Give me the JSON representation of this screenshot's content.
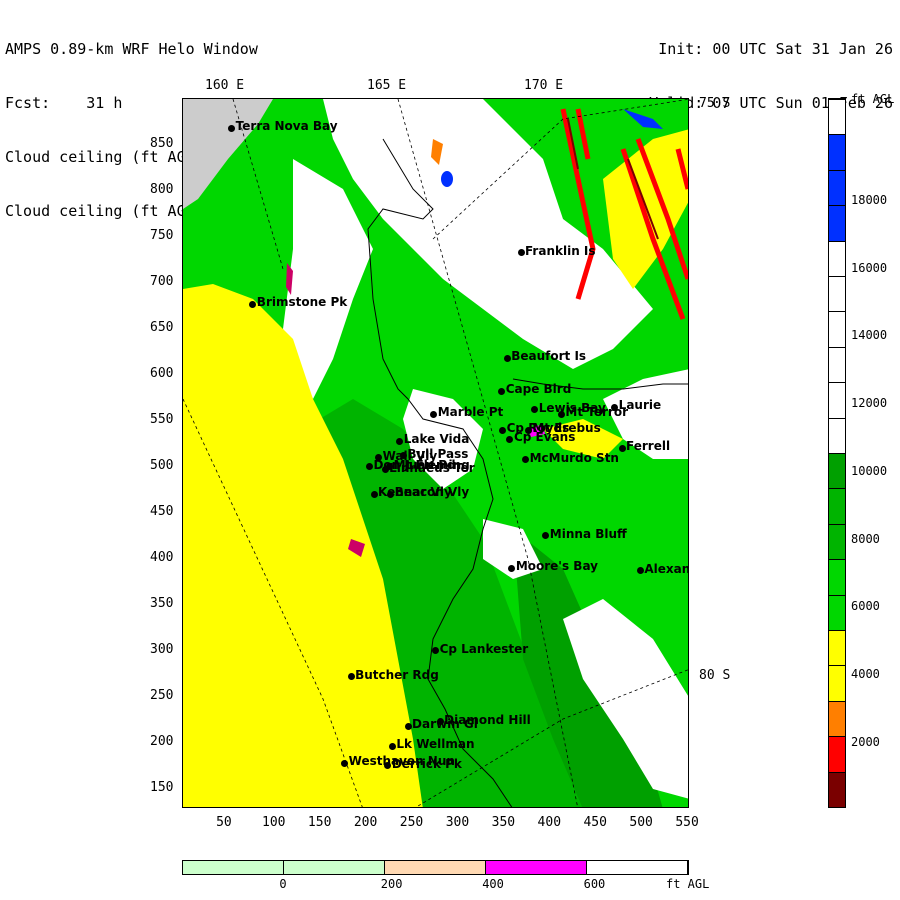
{
  "header": {
    "title_line": "AMPS 0.89-km WRF Helo Window",
    "fcst_line": "Fcst:    31 h",
    "field_line_1": "Cloud ceiling (ft AGL)",
    "field_line_2": "Cloud ceiling (ft AGL)",
    "init_line": "Init: 00 UTC Sat 31 Jan 26",
    "valid_line": "Valid: 07 UTC Sun 01 Feb 26"
  },
  "graticule": {
    "lon_labels": [
      "160 E",
      "165 E",
      "170 E"
    ],
    "lat_labels": [
      "75 S",
      "80 S"
    ]
  },
  "axes": {
    "x_ticks": [
      "50",
      "100",
      "150",
      "200",
      "250",
      "300",
      "350",
      "400",
      "450",
      "500",
      "550"
    ],
    "y_ticks": [
      "850",
      "800",
      "750",
      "700",
      "650",
      "600",
      "550",
      "500",
      "450",
      "400",
      "350",
      "300",
      "250",
      "200",
      "150"
    ]
  },
  "places": [
    {
      "name": "Terra Nova Bay",
      "x": 55,
      "y": 868
    },
    {
      "name": "Franklin Is",
      "x": 370,
      "y": 733
    },
    {
      "name": "Brimstone Pk",
      "x": 78,
      "y": 677
    },
    {
      "name": "Beaufort Is",
      "x": 355,
      "y": 618
    },
    {
      "name": "Cape Bird",
      "x": 349,
      "y": 582
    },
    {
      "name": "Lewis Bay",
      "x": 385,
      "y": 562
    },
    {
      "name": "Laurie",
      "x": 472,
      "y": 565
    },
    {
      "name": "Marble Pt",
      "x": 275,
      "y": 557
    },
    {
      "name": "Mt Terror",
      "x": 414,
      "y": 557
    },
    {
      "name": "Cp Royds",
      "x": 350,
      "y": 540
    },
    {
      "name": "Mt Erebus",
      "x": 378,
      "y": 540
    },
    {
      "name": "Lake Vida",
      "x": 238,
      "y": 528
    },
    {
      "name": "Cp Evans",
      "x": 358,
      "y": 530
    },
    {
      "name": "Ferrell",
      "x": 480,
      "y": 520
    },
    {
      "name": "Wall Vly",
      "x": 215,
      "y": 510
    },
    {
      "name": "Bull Pass",
      "x": 242,
      "y": 512
    },
    {
      "name": "McMurdo Stn",
      "x": 375,
      "y": 508
    },
    {
      "name": "Don Juan Pd",
      "x": 205,
      "y": 500
    },
    {
      "name": "Linnaeus Ter",
      "x": 222,
      "y": 497
    },
    {
      "name": "Mt Fleming",
      "x": 227,
      "y": 500
    },
    {
      "name": "Kennar Vly",
      "x": 210,
      "y": 470
    },
    {
      "name": "Beacon Vly",
      "x": 228,
      "y": 470
    },
    {
      "name": "Minna Bluff",
      "x": 397,
      "y": 425
    },
    {
      "name": "Moore's Bay",
      "x": 360,
      "y": 390
    },
    {
      "name": "Alexander",
      "x": 500,
      "y": 387
    },
    {
      "name": "Cp Lankester",
      "x": 277,
      "y": 300
    },
    {
      "name": "Butcher Rdg",
      "x": 185,
      "y": 272
    },
    {
      "name": "Diamond Hill",
      "x": 282,
      "y": 223
    },
    {
      "name": "Darwin Gl",
      "x": 247,
      "y": 218
    },
    {
      "name": "Lk Wellman",
      "x": 230,
      "y": 196
    },
    {
      "name": "Westhaven Nun",
      "x": 178,
      "y": 178
    },
    {
      "name": "Derrick Pk",
      "x": 225,
      "y": 175
    }
  ],
  "colorbar": {
    "units": "ft AGL",
    "labels": [
      "18000",
      "16000",
      "14000",
      "12000",
      "10000",
      "8000",
      "6000",
      "4000",
      "2000"
    ],
    "colors": [
      "#7a0000",
      "#ff0000",
      "#ff7f00",
      "#ffff00",
      "#ffff00",
      "#00d700",
      "#00d700",
      "#00b400",
      "#00b400",
      "#00a000",
      "#ffffff",
      "#ffffff",
      "#ffffff",
      "#ffffff",
      "#ffffff",
      "#ffffff",
      "#0030ff",
      "#0030ff",
      "#0030ff",
      "#ffffff"
    ]
  },
  "bottom_bar": {
    "labels": [
      "0",
      "200",
      "400",
      "600"
    ],
    "units": "ft AGL",
    "colors": [
      "#ccffcc",
      "#ccffcc",
      "#ffd9b3",
      "#ff00ff",
      "#ffffff"
    ]
  }
}
